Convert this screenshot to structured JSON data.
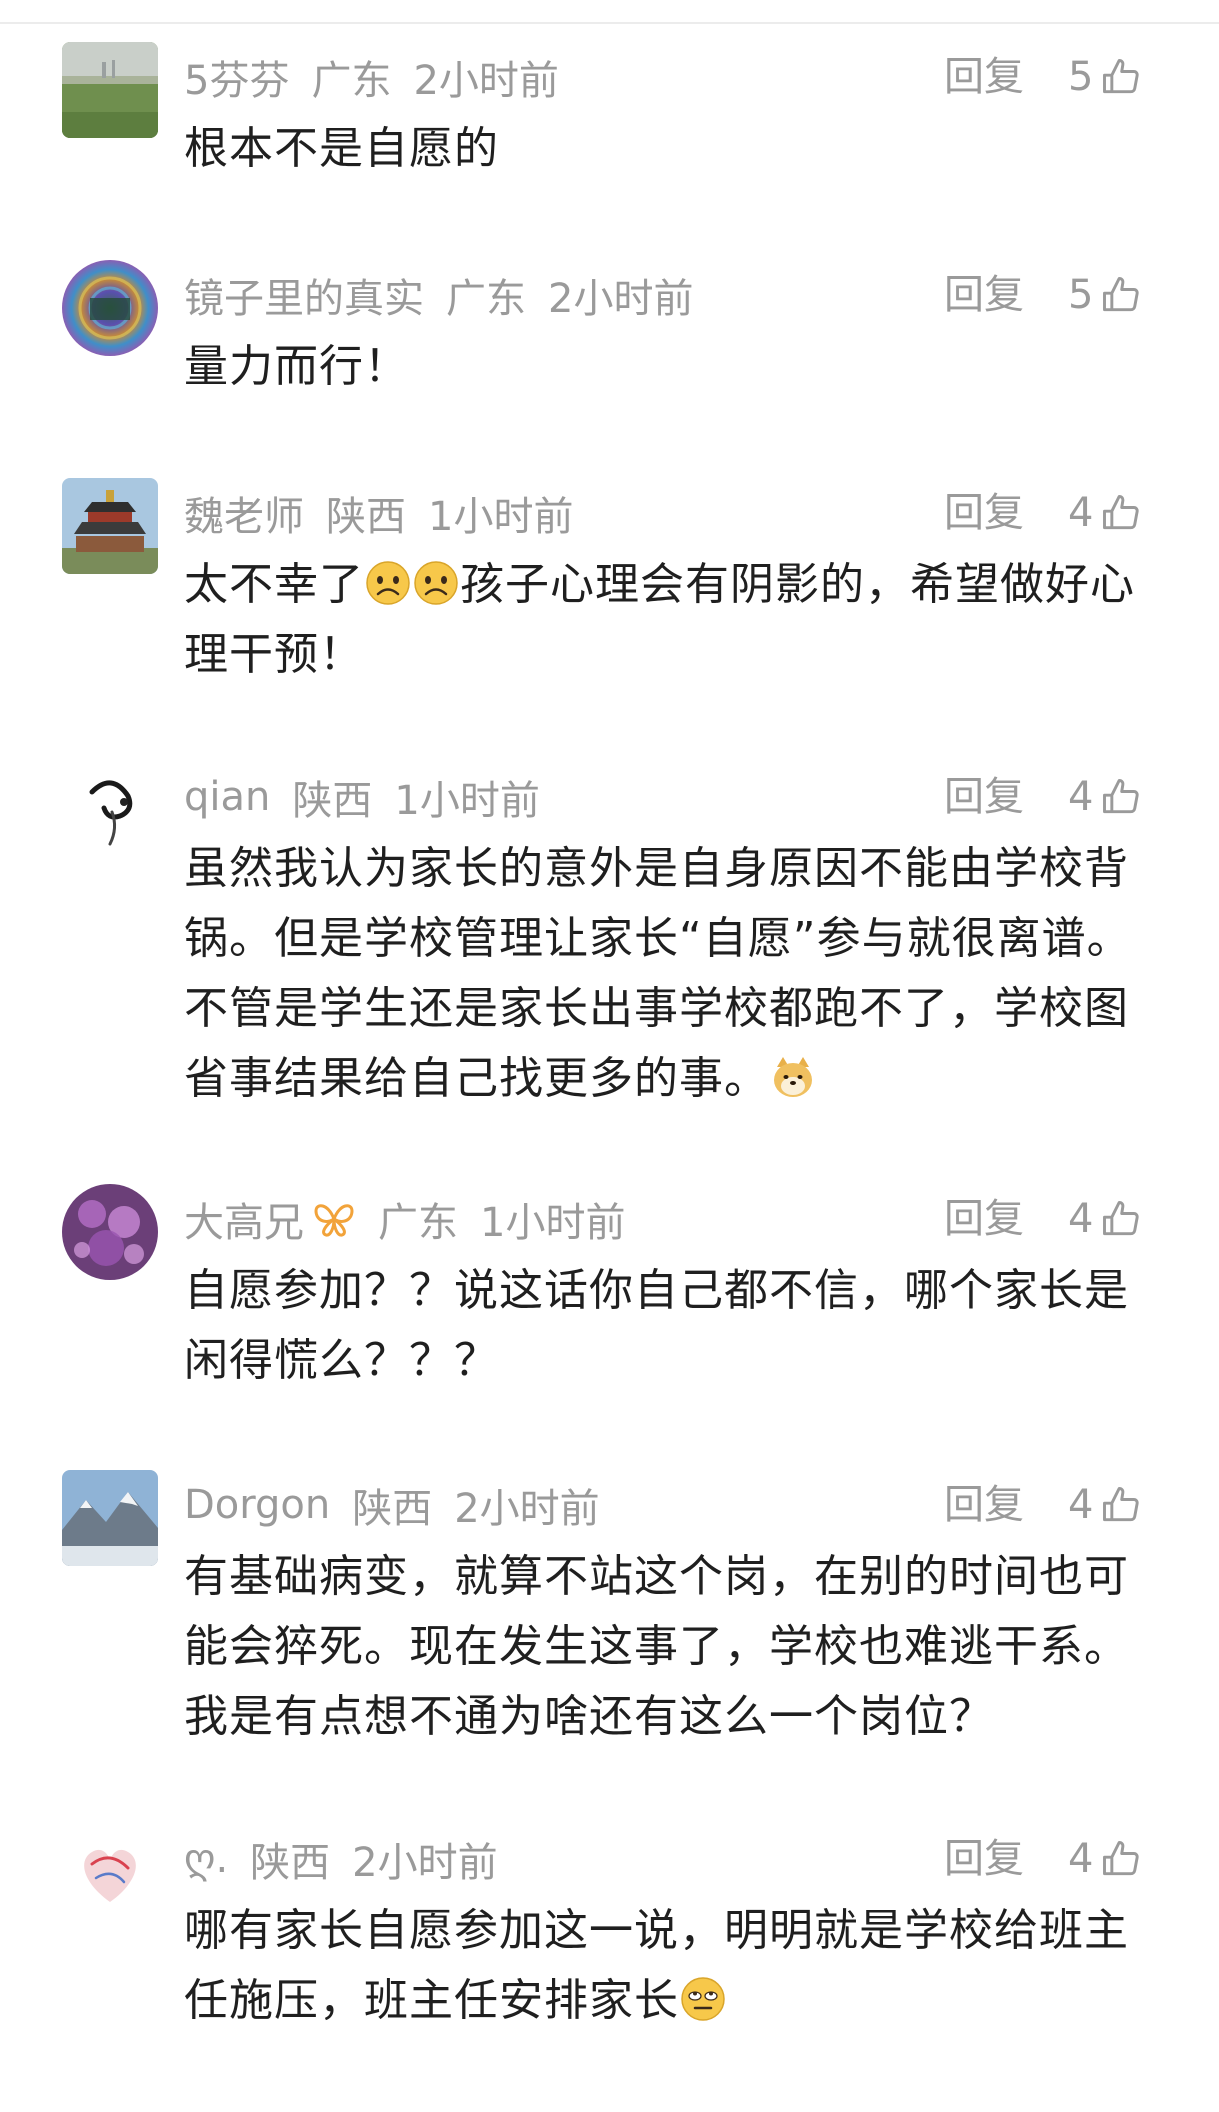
{
  "reply_label": "回复",
  "comments": [
    {
      "username": "5芬芬",
      "location": "广东",
      "time": "2小时前",
      "likes": "5",
      "text_parts": [
        "根本不是自愿的"
      ]
    },
    {
      "username": "镜子里的真实",
      "location": "广东",
      "time": "2小时前",
      "likes": "5",
      "text_parts": [
        "量力而行！"
      ]
    },
    {
      "username": "魏老师",
      "location": "陕西",
      "time": "1小时前",
      "likes": "4",
      "text_parts": [
        "太不幸了",
        "孩子心理会有阴影的，希望做好心理干预！"
      ],
      "emojis": [
        "sad-face-emoji",
        "sad-face-emoji"
      ]
    },
    {
      "username": "qian",
      "location": "陕西",
      "time": "1小时前",
      "likes": "4",
      "text_parts": [
        "虽然我认为家长的意外是自身原因不能由学校背锅。但是学校管理让家长“自愿”参与就很离谱。不管是学生还是家长出事学校都跑不了，学校图省事结果给自己找更多的事。"
      ],
      "emojis": [
        "doge-emoji"
      ]
    },
    {
      "username": "大高兄",
      "location": "广东",
      "time": "1小时前",
      "likes": "4",
      "text_parts": [
        "自愿参加？？说这话你自己都不信，哪个家长是闲得慌么？？？"
      ],
      "badge": "butterfly-badge-icon"
    },
    {
      "username": "Dorgon",
      "location": "陕西",
      "time": "2小时前",
      "likes": "4",
      "text_parts": [
        "有基础病变，就算不站这个岗，在别的时间也可能会猝死。现在发生这事了，学校也难逃干系。我是有点想不通为啥还有这么一个岗位？"
      ]
    },
    {
      "username": "ღ.",
      "location": "陕西",
      "time": "2小时前",
      "likes": "4",
      "text_parts": [
        "哪有家长自愿参加这一说，明明就是学校给班主任施压，班主任安排家长"
      ],
      "emojis": [
        "eye-roll-emoji"
      ]
    }
  ],
  "colors": {
    "meta_gray": "#9a9a9a",
    "text_dark": "#1f1f1f",
    "badge_orange": "#f2a33a"
  }
}
